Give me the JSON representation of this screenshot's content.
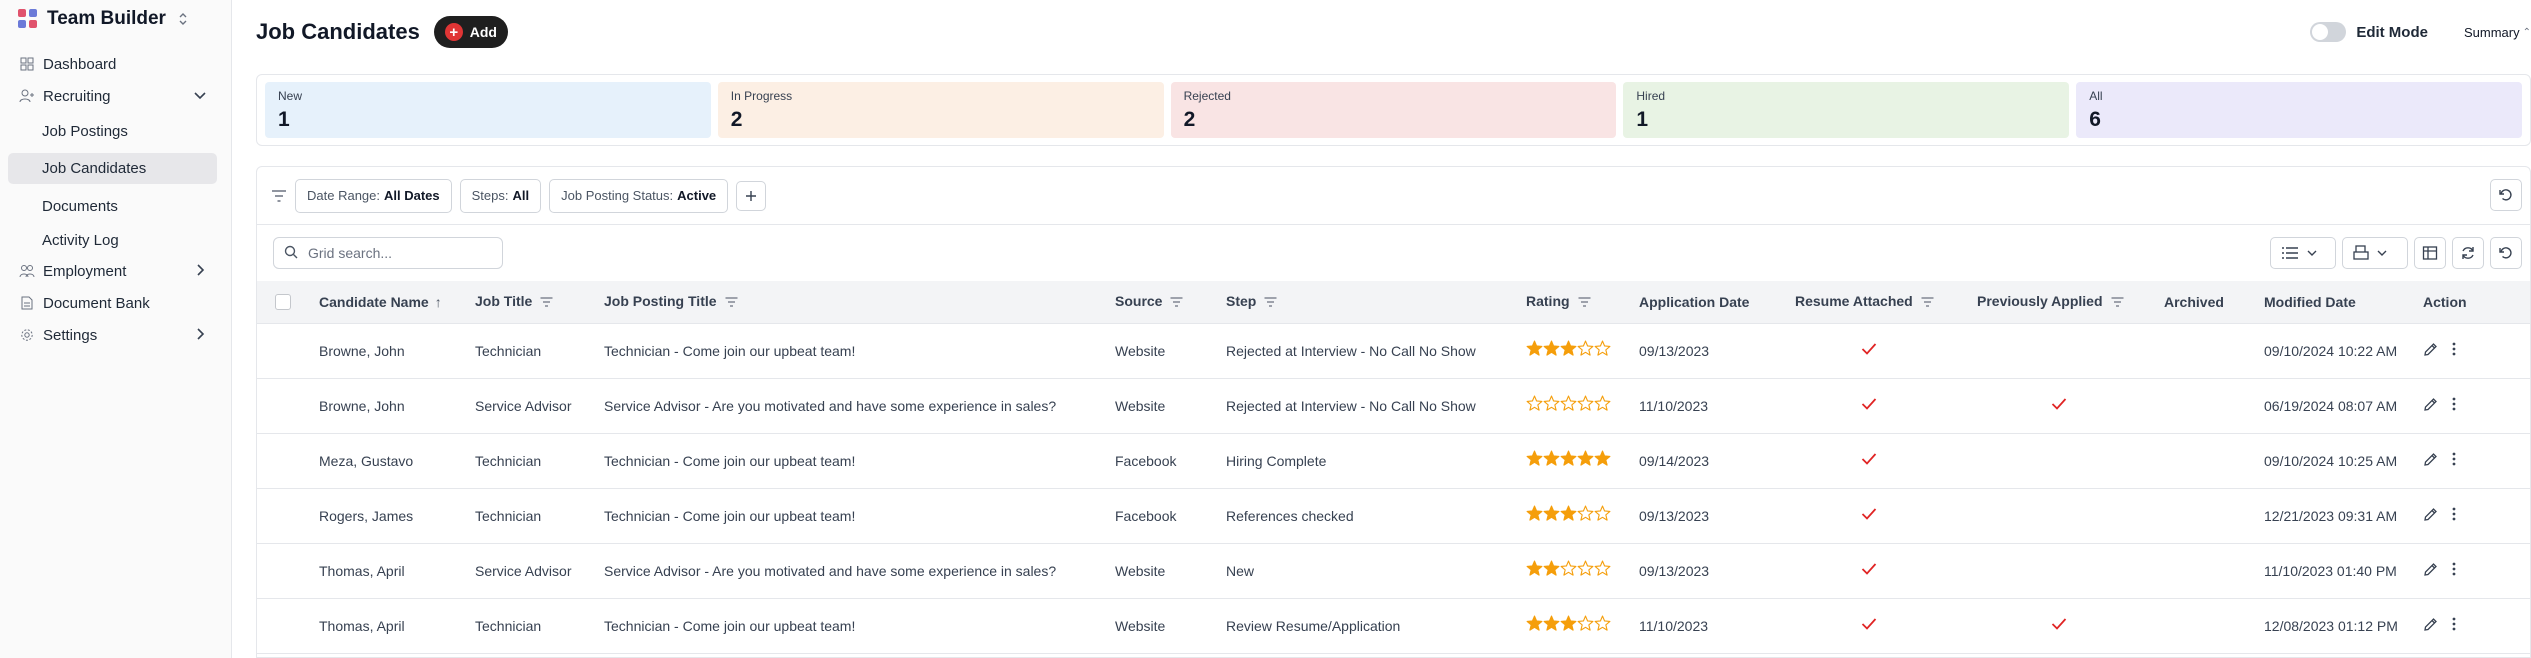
{
  "app": {
    "title": "Team Builder"
  },
  "sidebar": {
    "items": [
      {
        "label": "Dashboard",
        "icon": "dashboard-icon"
      },
      {
        "label": "Recruiting",
        "icon": "user-plus-icon"
      },
      {
        "label": "Employment",
        "icon": "users-icon"
      },
      {
        "label": "Document Bank",
        "icon": "document-icon"
      },
      {
        "label": "Settings",
        "icon": "gear-icon"
      }
    ],
    "recruiting_sub": [
      "Job Postings",
      "Job Candidates",
      "Documents",
      "Activity Log"
    ]
  },
  "header": {
    "title": "Job Candidates",
    "add_label": "Add",
    "edit_mode_label": "Edit Mode",
    "summary_label": "Summary"
  },
  "summary_cards": [
    {
      "label": "New",
      "value": "1",
      "color": "#e6f1fb"
    },
    {
      "label": "In Progress",
      "value": "2",
      "color": "#fcefe4"
    },
    {
      "label": "Rejected",
      "value": "2",
      "color": "#f9e4e4"
    },
    {
      "label": "Hired",
      "value": "1",
      "color": "#e8f3e4"
    },
    {
      "label": "All",
      "value": "6",
      "color": "#ebe9fa"
    }
  ],
  "filters": {
    "date_range": {
      "label": "Date Range:",
      "value": "All Dates"
    },
    "steps": {
      "label": "Steps:",
      "value": "All"
    },
    "posting_status": {
      "label": "Job Posting Status:",
      "value": "Active"
    }
  },
  "search": {
    "placeholder": "Grid search..."
  },
  "table": {
    "columns": [
      "Candidate Name",
      "Job Title",
      "Job Posting Title",
      "Source",
      "Step",
      "Rating",
      "Application Date",
      "Resume Attached",
      "Previously Applied",
      "Archived",
      "Modified Date",
      "Action"
    ],
    "rows": [
      {
        "name": "Browne, John",
        "job_title": "Technician",
        "posting": "Technician - Come join our upbeat team!",
        "source": "Website",
        "step": "Rejected at Interview - No Call No Show",
        "rating": 3,
        "app_date": "09/13/2023",
        "resume": true,
        "prev": false,
        "modified": "09/10/2024 10:22 AM"
      },
      {
        "name": "Browne, John",
        "job_title": "Service Advisor",
        "posting": "Service Advisor - Are you motivated and have some experience in sales?",
        "source": "Website",
        "step": "Rejected at Interview - No Call No Show",
        "rating": 0,
        "app_date": "11/10/2023",
        "resume": true,
        "prev": true,
        "modified": "06/19/2024 08:07 AM"
      },
      {
        "name": "Meza, Gustavo",
        "job_title": "Technician",
        "posting": "Technician - Come join our upbeat team!",
        "source": "Facebook",
        "step": "Hiring Complete",
        "rating": 5,
        "app_date": "09/14/2023",
        "resume": true,
        "prev": false,
        "modified": "09/10/2024 10:25 AM"
      },
      {
        "name": "Rogers, James",
        "job_title": "Technician",
        "posting": "Technician - Come join our upbeat team!",
        "source": "Facebook",
        "step": "References checked",
        "rating": 3,
        "app_date": "09/13/2023",
        "resume": true,
        "prev": false,
        "modified": "12/21/2023 09:31 AM"
      },
      {
        "name": "Thomas, April",
        "job_title": "Service Advisor",
        "posting": "Service Advisor - Are you motivated and have some experience in sales?",
        "source": "Website",
        "step": "New",
        "rating": 2,
        "app_date": "09/13/2023",
        "resume": true,
        "prev": false,
        "modified": "11/10/2023 01:40 PM"
      },
      {
        "name": "Thomas, April",
        "job_title": "Technician",
        "posting": "Technician - Come join our upbeat team!",
        "source": "Website",
        "step": "Review Resume/Application",
        "rating": 3,
        "app_date": "11/10/2023",
        "resume": true,
        "prev": true,
        "modified": "12/08/2023 01:12 PM"
      }
    ]
  }
}
